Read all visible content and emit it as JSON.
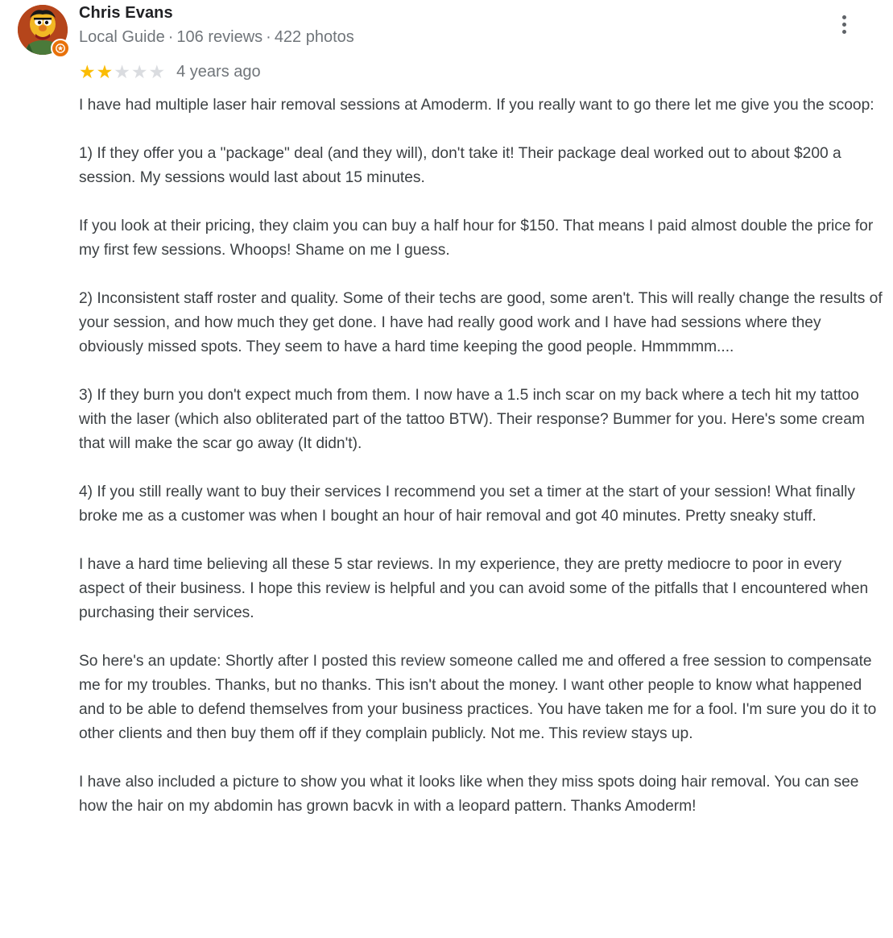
{
  "reviewer": {
    "name": "Chris Evans",
    "badge": "Local Guide",
    "reviews": "106 reviews",
    "photos": "422 photos",
    "separator": "·"
  },
  "rating": {
    "stars": 2,
    "max": 5,
    "date": "4 years ago",
    "filled_color": "#fbbc04",
    "empty_color": "#dadce0"
  },
  "icons": {
    "more": "more-vert-icon",
    "badge": "local-guide-star-icon"
  },
  "paragraphs": [
    "I have had multiple laser hair removal sessions at Amoderm. If you really want to go there let me give you the scoop:",
    "1) If they offer you a \"package\" deal (and they will), don't take it! Their package deal worked out to about $200 a session. My sessions would last about 15 minutes.",
    "If you look at their pricing, they claim you can buy a half hour for $150. That means I paid almost double the price for my first few sessions. Whoops! Shame on me I guess.",
    "2) Inconsistent staff roster and quality. Some of their techs are good, some aren't. This will really change the results of your session, and how much they get done. I have had really good work and I have had sessions where they obviously missed spots. They seem to have a hard time keeping the good people. Hmmmmm....",
    "3) If they burn you don't expect much from them. I now have a 1.5 inch scar on my back where a tech hit my tattoo with the laser (which also obliterated part of the tattoo BTW). Their response? Bummer for you. Here's some cream that will make the scar go away (It didn't).",
    "4) If you still really want to buy their services I recommend you set a timer at the start of your session! What finally broke me as a customer was when I bought an hour of hair removal and got 40 minutes. Pretty sneaky stuff.",
    "I have a hard time believing all these 5 star reviews. In my experience, they are pretty mediocre to poor in every aspect of their business. I hope this review is helpful and you can avoid some of the pitfalls that I encountered when purchasing their services.",
    "So here's an update: Shortly after I posted this review someone called me and offered a free session to compensate me for my troubles. Thanks, but no thanks. This isn't about the money. I want other people to know what happened and to be able to defend themselves from your business practices. You have taken me for a fool. I'm sure you do it to other clients and then buy them off if they complain publicly. Not me. This review stays up.",
    "I have also included a picture to show you what it looks like when they miss spots doing hair removal. You can see how the hair on my abdomin has grown bacvk in with a leopard pattern. Thanks Amoderm!"
  ]
}
